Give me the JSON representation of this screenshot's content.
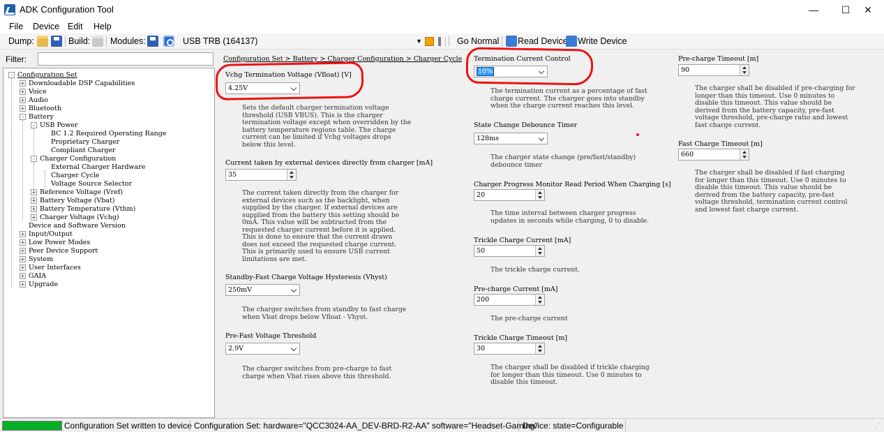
{
  "window": {
    "title": "ADK Configuration Tool",
    "minimize": "—",
    "maximize": "☐",
    "close": "✕"
  },
  "menu": [
    "File",
    "Device",
    "Edit",
    "Help"
  ],
  "toolbar": {
    "dump_label": "Dump:",
    "build_label": "Build:",
    "modules_label": "Modules:",
    "device_select": "USB TRB (164137)",
    "go_normal": "Go Normal",
    "read_device": "Read Device",
    "write_device": "Write Device"
  },
  "filter": {
    "label": "Filter:",
    "value": ""
  },
  "tree": [
    "Configuration Set",
    "Downloadable DSP Capabilities",
    "Voice",
    "Audio",
    "Bluetooth",
    "Battery",
    "USB Power",
    "BC 1.2 Required Operating Range",
    "Proprietary Charger",
    "Compliant Charger",
    "Charger Configuration",
    "External Charger Hardware",
    "Charger Cycle",
    "Voltage Source Selector",
    "Reference Voltage (Vref)",
    "Battery Voltage (Vbat)",
    "Battery Temperature (Vthm)",
    "Charger Voltage (Vchg)",
    "Device and Software Version",
    "Input/Output",
    "Low Power Modes",
    "Peer Device Support",
    "System",
    "User Interfaces",
    "GAIA",
    "Upgrade"
  ],
  "breadcrumb": "Configuration Set > Battery > Charger Configuration > Charger Cycle",
  "col1": {
    "vfloat_label": "Vchg Termination Voltage (Vfloat) [V]",
    "vfloat_value": "4.25V",
    "vfloat_desc": "Sets the default charger termination voltage\nthreshold (USB VBUS). This is the charger\ntermination voltage except when overridden by the\nbattery temperature regions table. The charge\ncurrent can be limited if Vchg voltages drops\nbelow this level.",
    "ext_label": "Current taken by external devices directly from charger [mA]",
    "ext_value": "35",
    "ext_desc": "The current taken directly from the charger for\nexternal devices such as the backlight, when\nsupplied by the charger. If external devices are\nsupplied from the battery this setting should be\n0mA. This value will be subtracted from the\nrequested charger current before it is applied.\nThis is done to ensure that the current drawn\ndoes not exceed the requested charge current.\nThis is primarily used to ensure USB current\nlimitations are met.",
    "vhyst_label": "Standby-Fast Charge Voltage Hysteresis (Vhyst)",
    "vhyst_value": "250mV",
    "vhyst_desc": "The charger switches from standby to fast charge\nwhen Vbat drops below Vfloat - Vhyst.",
    "prefast_label": "Pre-Fast Voltage Threshold",
    "prefast_value": "2.9V",
    "prefast_desc": "The charger switches from pre-charge to fast\ncharge when Vbat rises above this threshold."
  },
  "col2": {
    "term_label": "Termination Current Control",
    "term_value": "10%",
    "term_desc": "The termination current as a percentage of fast\ncharge current. The charger goes into standby\nwhen the charge current reaches this level.",
    "debounce_label": "State Change Debounce Timer",
    "debounce_value": "128ms",
    "debounce_desc": "The charger state change (pre/fast/standby)\ndebounce timer",
    "monitor_label": "Charger Progress Monitor Read Period When Charging [s]",
    "monitor_value": "20",
    "monitor_desc": "The time interval between charger progress\nupdates in seconds while charging, 0 to disable.",
    "trickle_label": "Trickle Charge Current [mA]",
    "trickle_value": "50",
    "trickle_desc": "The trickle charge current.",
    "precurrent_label": "Pre-charge Current [mA]",
    "precurrent_value": "200",
    "precurrent_desc": "The pre-charge current",
    "trickle_timeout_label": "Trickle Charge Timeout [m]",
    "trickle_timeout_value": "30",
    "trickle_timeout_desc": "The charger shall be disabled if trickle charging\nfor longer than this timeout. Use 0 minutes to\ndisable this timeout."
  },
  "col3": {
    "pre_timeout_label": "Pre-charge Timeout [m]",
    "pre_timeout_value": "90",
    "pre_timeout_desc": "The charger shall be disabled if pre-charging for\nlonger than this timeout. Use 0 minutes to\ndisable this timeout. This value should be\nderived from the battery capacity, pre-fast\nvoltage threshold, pre-charge ratio and lowest\nfast charge current.",
    "fast_timeout_label": "Fast Charge Timeout [m]",
    "fast_timeout_value": "660",
    "fast_timeout_desc": "The charger shall be disabled if fast charging\nfor longer than this timeout. Use 0 minutes to\ndisable this timeout. This value should be\nderived from the battery capacity, pre-fast\nvoltage threshold, termination current control\nand lowest fast charge current."
  },
  "status": {
    "progress": 1.0,
    "message": "Configuration Set written to device",
    "config": "Configuration Set:  hardware=\"QCC3024-AA_DEV-BRD-R2-AA\" software=\"Headset-Gaming\"",
    "device": "Device:  state=Configurable"
  },
  "colors": {
    "annotation": "#ee1111",
    "progress": "#06b025",
    "selection": "#3399ff"
  }
}
